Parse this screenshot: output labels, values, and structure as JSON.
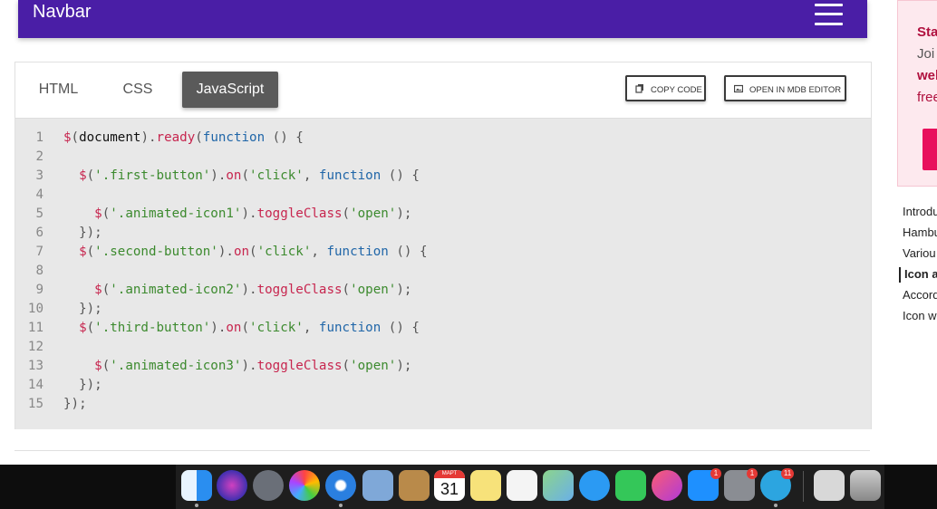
{
  "navbar": {
    "brand": "Navbar"
  },
  "tabs": [
    {
      "label": "HTML",
      "active": false
    },
    {
      "label": "CSS",
      "active": false
    },
    {
      "label": "JavaScript",
      "active": true
    }
  ],
  "actions": {
    "copy": "COPY CODE",
    "open": "OPEN IN MDB EDITOR"
  },
  "code_lines": [
    {
      "n": "1"
    },
    {
      "n": "2"
    },
    {
      "n": "3"
    },
    {
      "n": "4"
    },
    {
      "n": "5"
    },
    {
      "n": "6"
    },
    {
      "n": "7"
    },
    {
      "n": "8"
    },
    {
      "n": "9"
    },
    {
      "n": "10"
    },
    {
      "n": "11"
    },
    {
      "n": "12"
    },
    {
      "n": "13"
    },
    {
      "n": "14"
    },
    {
      "n": "15"
    }
  ],
  "code": {
    "l1": [
      [
        "fn",
        "$"
      ],
      [
        "p",
        "("
      ],
      [
        "pl",
        "document"
      ],
      [
        "p",
        ")."
      ],
      [
        "fn",
        "ready"
      ],
      [
        "p",
        "("
      ],
      [
        "kw",
        "function"
      ],
      [
        "p",
        " () {"
      ]
    ],
    "l3": [
      [
        "fn",
        "  $"
      ],
      [
        "p",
        "("
      ],
      [
        "str",
        "'.first-button'"
      ],
      [
        "p",
        ")."
      ],
      [
        "fn",
        "on"
      ],
      [
        "p",
        "("
      ],
      [
        "str",
        "'click'"
      ],
      [
        "p",
        ", "
      ],
      [
        "kw",
        "function"
      ],
      [
        "p",
        " () {"
      ]
    ],
    "l5": [
      [
        "fn",
        "    $"
      ],
      [
        "p",
        "("
      ],
      [
        "str",
        "'.animated-icon1'"
      ],
      [
        "p",
        ")."
      ],
      [
        "fn",
        "toggleClass"
      ],
      [
        "p",
        "("
      ],
      [
        "str",
        "'open'"
      ],
      [
        "p",
        ");"
      ]
    ],
    "l6": [
      [
        "p",
        "  });"
      ]
    ],
    "l7": [
      [
        "fn",
        "  $"
      ],
      [
        "p",
        "("
      ],
      [
        "str",
        "'.second-button'"
      ],
      [
        "p",
        ")."
      ],
      [
        "fn",
        "on"
      ],
      [
        "p",
        "("
      ],
      [
        "str",
        "'click'"
      ],
      [
        "p",
        ", "
      ],
      [
        "kw",
        "function"
      ],
      [
        "p",
        " () {"
      ]
    ],
    "l9": [
      [
        "fn",
        "    $"
      ],
      [
        "p",
        "("
      ],
      [
        "str",
        "'.animated-icon2'"
      ],
      [
        "p",
        ")."
      ],
      [
        "fn",
        "toggleClass"
      ],
      [
        "p",
        "("
      ],
      [
        "str",
        "'open'"
      ],
      [
        "p",
        ");"
      ]
    ],
    "l10": [
      [
        "p",
        "  });"
      ]
    ],
    "l11": [
      [
        "fn",
        "  $"
      ],
      [
        "p",
        "("
      ],
      [
        "str",
        "'.third-button'"
      ],
      [
        "p",
        ")."
      ],
      [
        "fn",
        "on"
      ],
      [
        "p",
        "("
      ],
      [
        "str",
        "'click'"
      ],
      [
        "p",
        ", "
      ],
      [
        "kw",
        "function"
      ],
      [
        "p",
        " () {"
      ]
    ],
    "l13": [
      [
        "fn",
        "    $"
      ],
      [
        "p",
        "("
      ],
      [
        "str",
        "'.animated-icon3'"
      ],
      [
        "p",
        ")."
      ],
      [
        "fn",
        "toggleClass"
      ],
      [
        "p",
        "("
      ],
      [
        "str",
        "'open'"
      ],
      [
        "p",
        ");"
      ]
    ],
    "l14": [
      [
        "p",
        "  });"
      ]
    ],
    "l15": [
      [
        "p",
        "});"
      ]
    ]
  },
  "promo": {
    "line1": "Sta",
    "line2": "Joi",
    "line3": "wel",
    "line4": "free"
  },
  "toc": [
    {
      "label": "Introdu",
      "active": false
    },
    {
      "label": "Hambu",
      "active": false
    },
    {
      "label": "Variou",
      "active": false
    },
    {
      "label": "Icon a",
      "active": true
    },
    {
      "label": "Accord",
      "active": false
    },
    {
      "label": "Icon w",
      "active": false
    }
  ],
  "dock": {
    "calendar_month": "МАРТ",
    "calendar_day": "31",
    "badges": {
      "app_store": "1",
      "system_prefs": "1",
      "telegram": "11"
    }
  },
  "colors": {
    "navbar": "#4a1ea6",
    "active_tab": "#5a5a5a",
    "code_bg": "#e8e8e8",
    "accent_red": "#e8105c"
  }
}
